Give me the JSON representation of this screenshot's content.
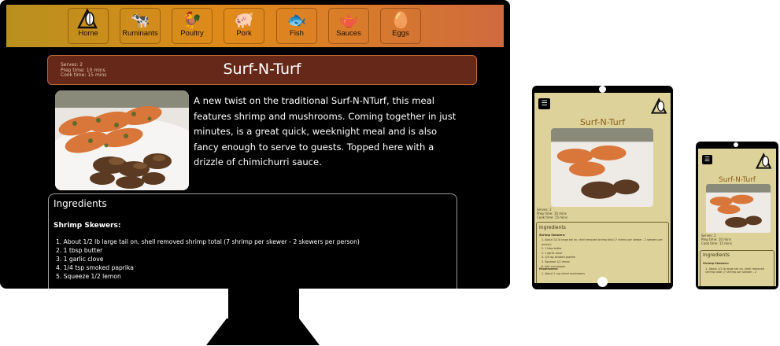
{
  "nav": {
    "items": [
      {
        "label": "Home",
        "icon": "home-logo-icon",
        "glyph": "A"
      },
      {
        "label": "Ruminants",
        "icon": "cow-icon",
        "glyph": "🐄"
      },
      {
        "label": "Poultry",
        "icon": "chicken-icon",
        "glyph": "🐓"
      },
      {
        "label": "Pork",
        "icon": "pig-icon",
        "glyph": "🐖"
      },
      {
        "label": "Fish",
        "icon": "fish-icon",
        "glyph": "🐟"
      },
      {
        "label": "Sauces",
        "icon": "gravy-boat-icon",
        "glyph": "🫖"
      },
      {
        "label": "Eggs",
        "icon": "eggs-icon",
        "glyph": "🥚"
      }
    ]
  },
  "recipe": {
    "title": "Surf-N-Turf",
    "serves": "Serves: 2",
    "prep": "Prep time: 10 mins",
    "cook": "Cook time: 15 mins",
    "description": "A new twist on the traditional Surf-N-NTurf, this meal features shrimp and mushrooms. Coming together in just minutes, is a great quick, weeknight meal and is also fancy enough to serve to guests. Topped here with a drizzle of chimichurri sauce."
  },
  "ingredients": {
    "heading": "Ingredients",
    "section": "Shrimp Skewers:",
    "items": [
      "1. About 1/2 lb large tail on, shell removed shrimp total (7 shrimp per skewer - 2 skewers per person)",
      "2. 1 tbsp butter",
      "3. 1 garlic clove",
      "4. 1/4 tsp smoked paprika",
      "5. Squeeze 1/2 lemon"
    ]
  },
  "tablet": {
    "title": "Surf-N-Turf",
    "serves": "Serves: 2",
    "prep": "Prep time: 10 mins",
    "cook": "Cook time: 15 mins",
    "ingredients": "Ingredients",
    "section": "Shrimp Skewers:",
    "items": [
      "1. About 1/2 lb large tail on, shell removed shrimp total (7 shrimp per skewer - 2 skewers per person)",
      "2. 1 tbsp butter",
      "3. 1 garlic clove",
      "4. 1/4 tsp smoked paprika",
      "5. Squeeze 1/2 lemon",
      "6. Salt and pepper"
    ],
    "section2": "Mushrooms:",
    "item2": "1. About 1 cup sliced mushrooms"
  },
  "phone": {
    "title": "Surf-N-Turf",
    "serves": "Serves: 2",
    "prep": "Prep time: 10 mins",
    "cook": "Cook time: 15 mins",
    "ingredients": "Ingredients",
    "section": "Shrimp Skewers:",
    "item": "1. About 1/2 lb large tail on, shell removed shrimp total (7 shrimp per skewer - 2"
  }
}
